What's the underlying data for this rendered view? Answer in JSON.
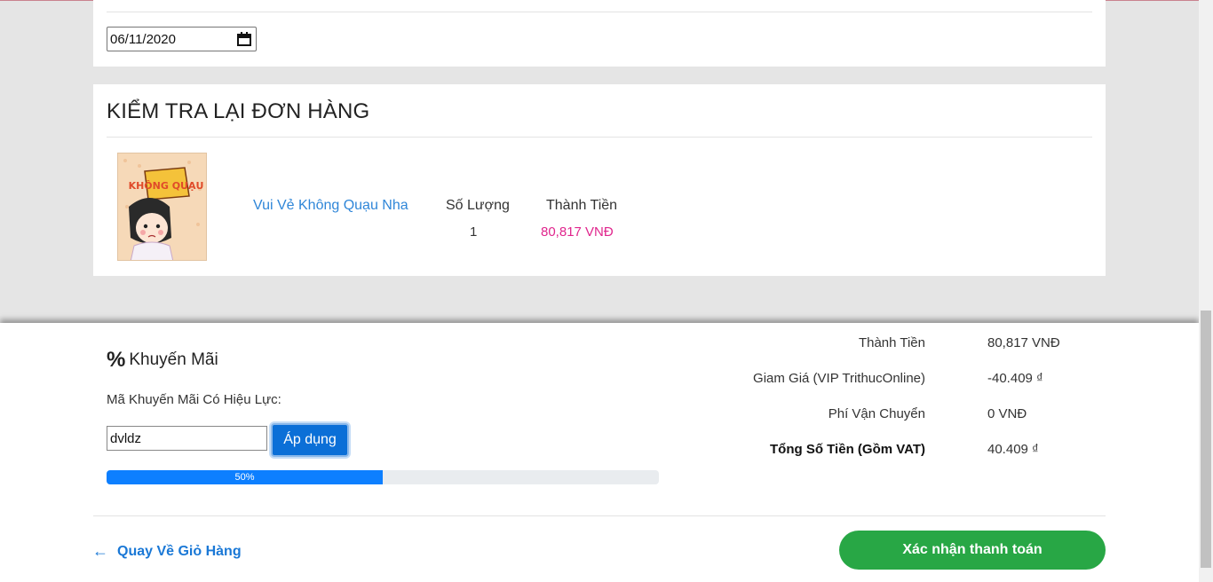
{
  "date_section": {
    "date_value": "06/11/2020",
    "icon": "calendar-icon"
  },
  "review": {
    "title": "KIỂM TRA LẠI ĐƠN HÀNG",
    "product": {
      "name": "Vui Vẻ Không Quạu Nha",
      "quantity_header": "Số Lượng",
      "quantity": "1",
      "price_header": "Thành Tiền",
      "price": "80,817 VNĐ",
      "cover_text": "KHÔNG QUẠU"
    }
  },
  "promo": {
    "title": "Khuyến Mãi",
    "icon": "percent-icon",
    "label": "Mã Khuyến Mãi Có Hiệu Lực:",
    "code_value": "dvldz",
    "apply_label": "Áp dụng",
    "progress_label": "50%",
    "progress_fraction": 0.5
  },
  "summary": {
    "rows": [
      {
        "label": "Thành Tiền",
        "value": "80,817 VNĐ"
      },
      {
        "label": "Giam Giá (VIP TrithucOnline)",
        "value": "-40.409 ₫"
      },
      {
        "label": "Phí Vận Chuyển",
        "value": "0 VNĐ"
      },
      {
        "label": "Tổng Số Tiền (Gồm VAT)",
        "value": "40.409 ₫"
      }
    ]
  },
  "footer": {
    "back_label": "Quay Về Giỏ Hàng",
    "confirm_label": "Xác nhận thanh toán"
  },
  "colors": {
    "link": "#2f86d8",
    "price": "#e0268d",
    "primary": "#0b6fd7",
    "success": "#28a745"
  }
}
